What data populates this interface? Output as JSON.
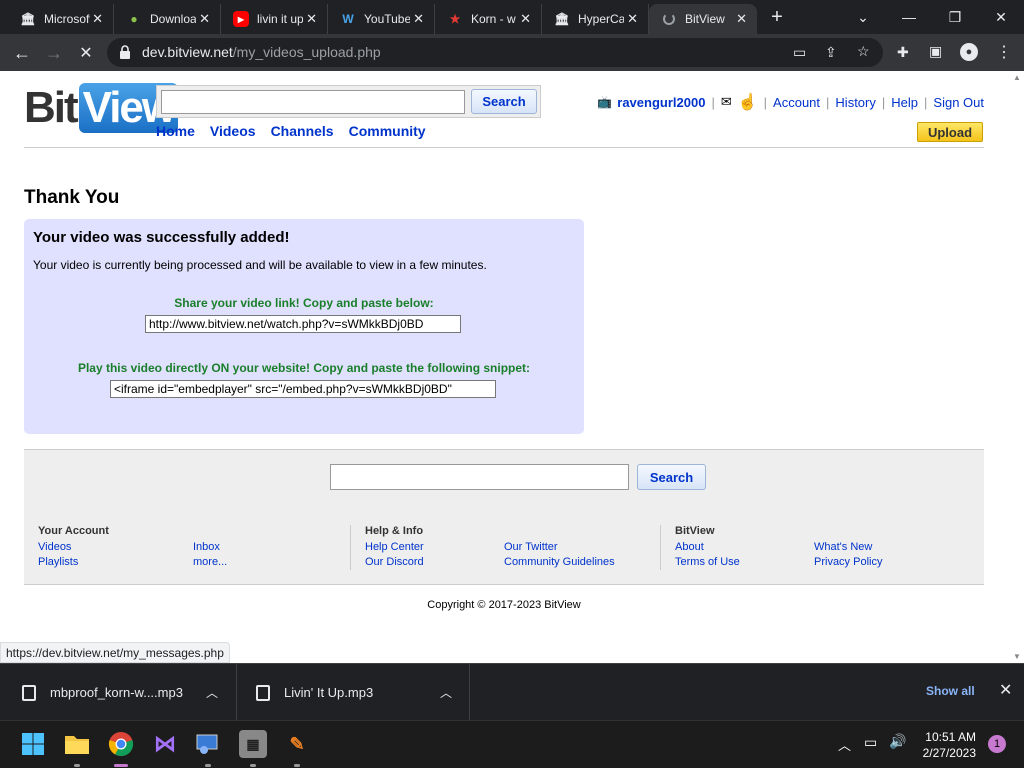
{
  "browser": {
    "tabs": [
      {
        "title": "Microsoft",
        "icon": "bank-icon"
      },
      {
        "title": "Download",
        "icon": "download-site-icon"
      },
      {
        "title": "livin it up",
        "icon": "youtube-icon"
      },
      {
        "title": "YouTube",
        "icon": "w-icon"
      },
      {
        "title": "Korn - w",
        "icon": "star-icon"
      },
      {
        "title": "HyperCam",
        "icon": "bank-icon"
      },
      {
        "title": "BitView",
        "icon": "loading-spinner-icon"
      }
    ],
    "active_tab_index": 6,
    "url_host": "dev.bitview.net",
    "url_path": "/my_videos_upload.php",
    "status_url": "https://dev.bitview.net/my_messages.php"
  },
  "site": {
    "logo_bit": "Bit",
    "logo_view": "View",
    "search_button": "Search",
    "nav": [
      "Home",
      "Videos",
      "Channels",
      "Community"
    ],
    "username": "ravengurl2000",
    "links": [
      "Account",
      "History",
      "Help",
      "Sign Out"
    ],
    "upload_button": "Upload"
  },
  "main": {
    "page_title": "Thank You",
    "success_heading": "Your video was successfully added!",
    "processing_text": "Your video is currently being processed and will be available to view in a few minutes.",
    "share_label": "Share your video link! Copy and paste below:",
    "share_url": "http://www.bitview.net/watch.php?v=sWMkkBDj0BD",
    "embed_label": "Play this video directly ON your website! Copy and paste the following snippet:",
    "embed_code": "<iframe id=\"embedplayer\" src=\"/embed.php?v=sWMkkBDj0BD\""
  },
  "footer": {
    "search_button": "Search",
    "your_account": {
      "heading": "Your Account",
      "col1": [
        "Videos",
        "Playlists"
      ],
      "col2": [
        "Inbox",
        "more..."
      ]
    },
    "help_info": {
      "heading": "Help & Info",
      "col1": [
        "Help Center",
        "Our Discord"
      ],
      "col2": [
        "Our Twitter",
        "Community Guidelines"
      ]
    },
    "bitview": {
      "heading": "BitView",
      "col1": [
        "About",
        "Terms of Use"
      ],
      "col2": [
        "What's New",
        "Privacy Policy"
      ]
    },
    "copyright": "Copyright © 2017-2023 BitView"
  },
  "downloads": {
    "items": [
      "mbproof_korn-w....mp3",
      "Livin' It Up.mp3"
    ],
    "show_all": "Show all"
  },
  "taskbar": {
    "time": "10:51 AM",
    "date": "2/27/2023",
    "notification_count": "1"
  },
  "colors": {
    "link": "#0033cc",
    "success_bg": "#e0e0ff",
    "green": "#1a7f2a",
    "upload": "#f4c31b"
  }
}
